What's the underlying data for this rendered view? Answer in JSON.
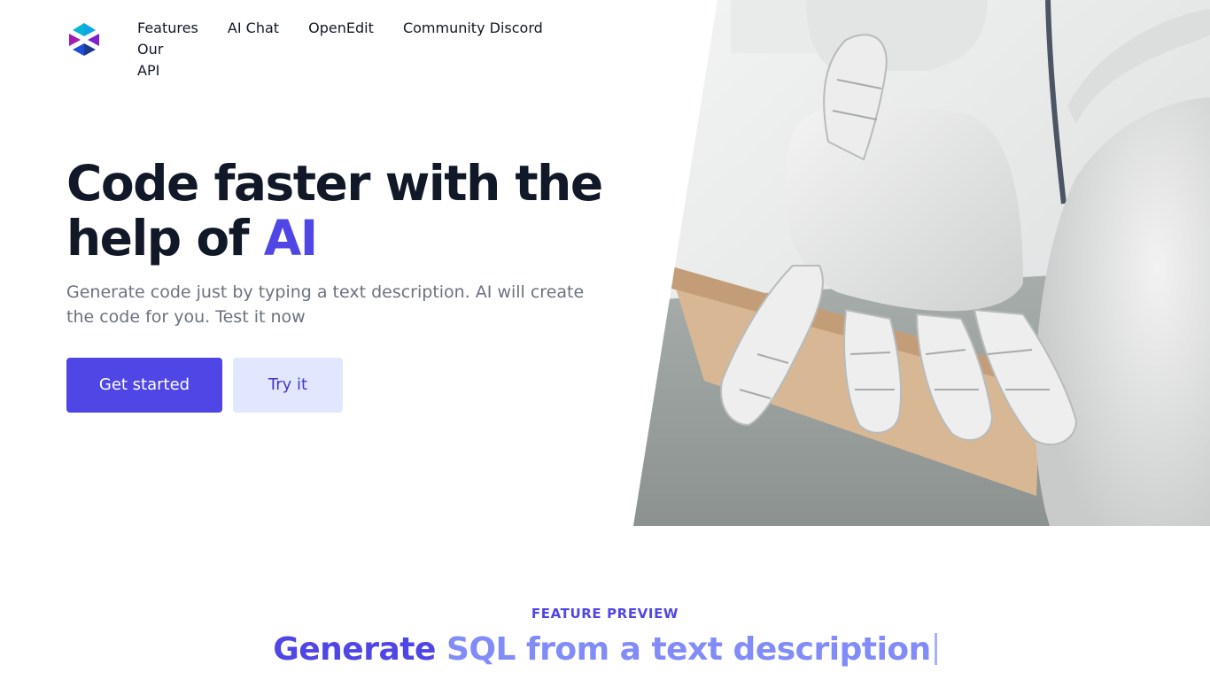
{
  "nav": {
    "logo_name": "brand-logo",
    "items": [
      {
        "label": "Features"
      },
      {
        "label": "AI Chat"
      },
      {
        "label": "OpenEdit"
      },
      {
        "label": "Community Discord"
      },
      {
        "label": "Our API"
      }
    ]
  },
  "hero": {
    "title_main": "Code faster with the help of ",
    "title_accent": "AI",
    "subtitle": "Generate code just by typing a text description. AI will create the code for you. Test it now",
    "primary_button": "Get started",
    "secondary_button": "Try it",
    "image_icon": "robot-hand-image"
  },
  "feature": {
    "label": "FEATURE PREVIEW",
    "title_dark": "Generate",
    "title_light": "SQL from a text description"
  },
  "colors": {
    "accent": "#4f46e5",
    "accent_light": "#818cf8",
    "secondary_button_bg": "#e0e7ff",
    "text_dark": "#111827",
    "text_muted": "#6b7280"
  }
}
